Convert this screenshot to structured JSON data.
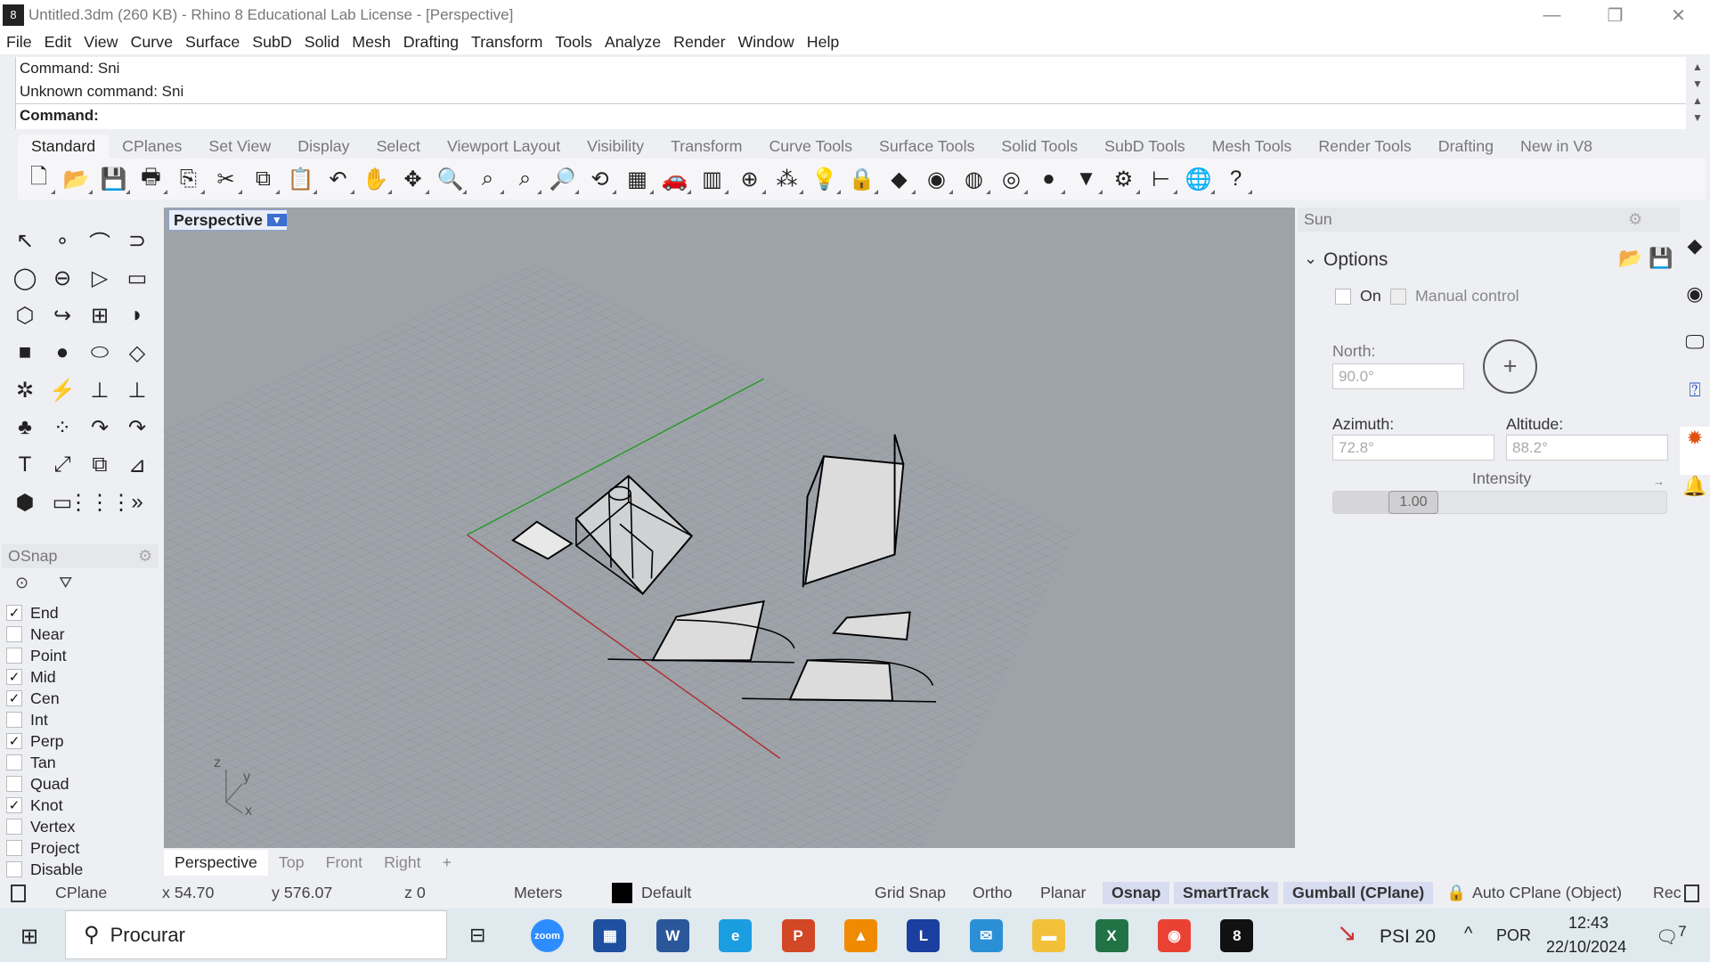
{
  "window": {
    "title": "Untitled.3dm (260 KB) - Rhino 8 Educational Lab License - [Perspective]",
    "minimize": "—",
    "restore": "❐",
    "close": "✕"
  },
  "menu": [
    "File",
    "Edit",
    "View",
    "Curve",
    "Surface",
    "SubD",
    "Solid",
    "Mesh",
    "Drafting",
    "Transform",
    "Tools",
    "Analyze",
    "Render",
    "Window",
    "Help"
  ],
  "command": {
    "history": [
      "Command: Sni",
      "Unknown command: Sni"
    ],
    "prompt": "Command:"
  },
  "toolbar_tabs": [
    "Standard",
    "CPlanes",
    "Set View",
    "Display",
    "Select",
    "Viewport Layout",
    "Visibility",
    "Transform",
    "Curve Tools",
    "Surface Tools",
    "Solid Tools",
    "SubD Tools",
    "Mesh Tools",
    "Render Tools",
    "Drafting",
    "New in V8"
  ],
  "toolbar_icons": [
    {
      "name": "new-icon",
      "g": "🗋"
    },
    {
      "name": "open-icon",
      "g": "📂"
    },
    {
      "name": "save-icon",
      "g": "💾"
    },
    {
      "name": "print-icon",
      "g": "🖶"
    },
    {
      "name": "import-icon",
      "g": "⎘"
    },
    {
      "name": "cut-icon",
      "g": "✂"
    },
    {
      "name": "copy-icon",
      "g": "⧉"
    },
    {
      "name": "paste-icon",
      "g": "📋"
    },
    {
      "name": "undo-icon",
      "g": "↶"
    },
    {
      "name": "pan-icon",
      "g": "✋"
    },
    {
      "name": "rotate-view-icon",
      "g": "✥"
    },
    {
      "name": "zoom-dynamic-icon",
      "g": "🔍"
    },
    {
      "name": "zoom-window-icon",
      "g": "⌕"
    },
    {
      "name": "zoom-extents-icon",
      "g": "⌕"
    },
    {
      "name": "zoom-selected-icon",
      "g": "🔎"
    },
    {
      "name": "rotate-icon",
      "g": "⟲"
    },
    {
      "name": "four-viewports-icon",
      "g": "▦"
    },
    {
      "name": "car-icon",
      "g": "🚗"
    },
    {
      "name": "grid-icon",
      "g": "▥"
    },
    {
      "name": "osnap-icon",
      "g": "⊕"
    },
    {
      "name": "points-icon",
      "g": "⁂"
    },
    {
      "name": "light-icon",
      "g": "💡"
    },
    {
      "name": "lock-icon",
      "g": "🔒"
    },
    {
      "name": "layers-icon",
      "g": "◆"
    },
    {
      "name": "color-wheel-icon",
      "g": "◉"
    },
    {
      "name": "wireframe-sphere-icon",
      "g": "◍"
    },
    {
      "name": "shaded-sphere-icon",
      "g": "◎"
    },
    {
      "name": "render-sphere-icon",
      "g": "●"
    },
    {
      "name": "spotlight-icon",
      "g": "▼"
    },
    {
      "name": "options-gear-icon",
      "g": "⚙"
    },
    {
      "name": "dimension-icon",
      "g": "⊢"
    },
    {
      "name": "globe-icon",
      "g": "🌐"
    },
    {
      "name": "help-icon",
      "g": "?"
    }
  ],
  "left_tools": [
    "↖",
    "∘",
    "⌒",
    "⊃",
    "◯",
    "⊖",
    "▷",
    "▭",
    "⬡",
    "↪",
    "⊞",
    "◗",
    "■",
    "●",
    "⬭",
    "◇",
    "✲",
    "⚡",
    "⊥",
    "⊥",
    "♣",
    "⁘",
    "↷",
    "↷",
    "T",
    "⤢",
    "⧉",
    "⊿",
    "⬢",
    "▭",
    "⋮⋮⋮",
    "»"
  ],
  "osnap": {
    "title": "OSnap",
    "items": [
      {
        "label": "End",
        "checked": true
      },
      {
        "label": "Near",
        "checked": false
      },
      {
        "label": "Point",
        "checked": false
      },
      {
        "label": "Mid",
        "checked": true
      },
      {
        "label": "Cen",
        "checked": true
      },
      {
        "label": "Int",
        "checked": false
      },
      {
        "label": "Perp",
        "checked": true
      },
      {
        "label": "Tan",
        "checked": false
      },
      {
        "label": "Quad",
        "checked": false
      },
      {
        "label": "Knot",
        "checked": true
      },
      {
        "label": "Vertex",
        "checked": false
      },
      {
        "label": "Project",
        "checked": false
      },
      {
        "label": "Disable",
        "checked": false
      }
    ]
  },
  "viewport": {
    "label": "Perspective",
    "axes": {
      "z": "z",
      "y": "y",
      "x": "x"
    },
    "colors": {
      "background": "#9ea3aa",
      "x_axis": "#b03030",
      "y_axis": "#2a9a2a"
    }
  },
  "viewport_tabs": [
    "Perspective",
    "Top",
    "Front",
    "Right",
    "+"
  ],
  "status": {
    "cplane": "CPlane",
    "x": "x 54.70",
    "y": "y 576.07",
    "z": "z 0",
    "units": "Meters",
    "layer": "Default",
    "grid_snap": "Grid Snap",
    "ortho": "Ortho",
    "planar": "Planar",
    "osnap": "Osnap",
    "smarttrack": "SmartTrack",
    "gumball": "Gumball (CPlane)",
    "auto_cplane": "Auto CPlane (Object)",
    "rec": "Rec"
  },
  "sun": {
    "title": "Sun",
    "section": "Options",
    "on_label": "On",
    "on_checked": false,
    "manual_label": "Manual control",
    "manual_checked": false,
    "north_label": "North:",
    "north_value": "90.0°",
    "azimuth_label": "Azimuth:",
    "azimuth_value": "72.8°",
    "altitude_label": "Altitude:",
    "altitude_value": "88.2°",
    "intensity_label": "Intensity",
    "intensity_value": "1.00"
  },
  "taskbar": {
    "search_placeholder": "Procurar",
    "ticker": "PSI 20",
    "lang": "POR",
    "time": "12:43",
    "date": "22/10/2024",
    "notifications": "7",
    "apps": [
      {
        "name": "zoom",
        "label": "zoom",
        "color": "#2d8cff"
      },
      {
        "name": "store",
        "label": "▦",
        "color": "#1e4fa0"
      },
      {
        "name": "word",
        "label": "W",
        "color": "#2b579a"
      },
      {
        "name": "edge",
        "label": "e",
        "color": "#1b9de2"
      },
      {
        "name": "powerpoint",
        "label": "P",
        "color": "#d24726"
      },
      {
        "name": "vlc",
        "label": "▲",
        "color": "#f08a00"
      },
      {
        "name": "l-app",
        "label": "L",
        "color": "#1a3fa0"
      },
      {
        "name": "mail",
        "label": "✉",
        "color": "#2b8fd6"
      },
      {
        "name": "explorer",
        "label": "▬",
        "color": "#f3c03a"
      },
      {
        "name": "excel",
        "label": "X",
        "color": "#217346"
      },
      {
        "name": "chrome-like",
        "label": "◉",
        "color": "#e94235"
      },
      {
        "name": "rhino",
        "label": "8",
        "color": "#111"
      }
    ]
  }
}
